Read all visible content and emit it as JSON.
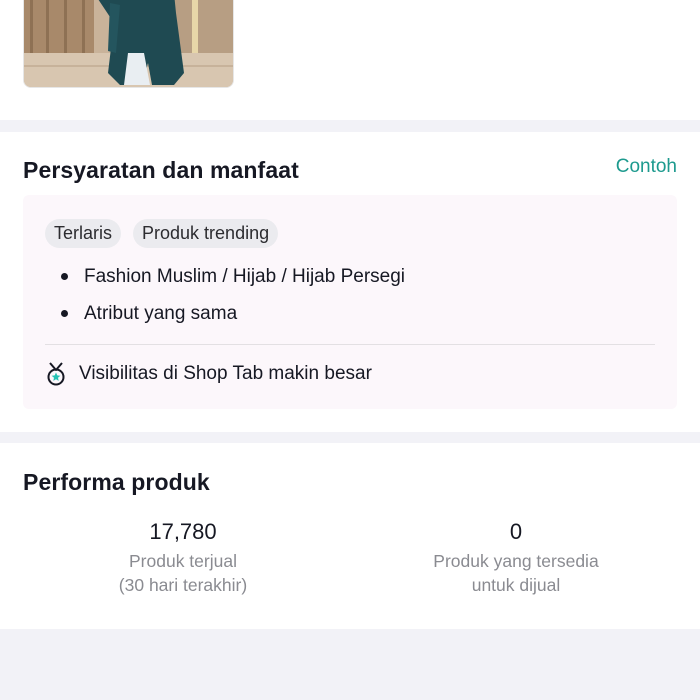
{
  "requirements": {
    "title": "Persyaratan dan manfaat",
    "example_link": "Contoh",
    "tags": [
      "Terlaris",
      "Produk trending"
    ],
    "bullets": [
      "Fashion Muslim / Hijab / Hijab Persegi",
      "Atribut yang sama"
    ],
    "benefit": {
      "icon": "medal-icon",
      "text": "Visibilitas di Shop Tab makin besar"
    }
  },
  "performance": {
    "title": "Performa produk",
    "metrics": [
      {
        "value": "17,780",
        "label_line1": "Produk terjual",
        "label_line2": "(30 hari terakhir)"
      },
      {
        "value": "0",
        "label_line1": "Produk yang tersedia",
        "label_line2": "untuk dijual"
      }
    ]
  },
  "colors": {
    "accent": "#1d9a8e",
    "page_background": "#f2f2f7",
    "card_background": "#ffffff",
    "requirement_box": "#fcf7fb",
    "tag_background": "#ebebef",
    "muted_text": "#8a8b91"
  }
}
